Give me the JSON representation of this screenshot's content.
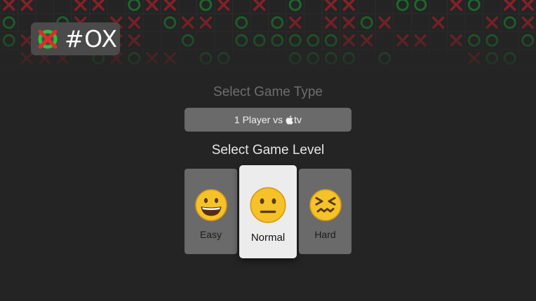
{
  "logo": {
    "text": "#OX",
    "icon": "red-green-x-o-logo-icon"
  },
  "game_type": {
    "title": "Select Game Type",
    "selected_prefix": "1 Player vs",
    "selected_suffix": "tv",
    "brand_icon": "apple-icon"
  },
  "game_level": {
    "title": "Select Game Level",
    "levels": [
      {
        "label": "Easy",
        "icon": "grinning-face-icon",
        "focused": false
      },
      {
        "label": "Normal",
        "icon": "neutral-face-icon",
        "focused": true
      },
      {
        "label": "Hard",
        "icon": "confounded-face-icon",
        "focused": false
      }
    ]
  },
  "colors": {
    "background": "#242424",
    "x_mark": "#8a2028",
    "o_mark": "#1d6b2c",
    "panel": "#6a6a6a",
    "focused_card": "#ececec",
    "emoji_yellow": "#f5c22a"
  }
}
